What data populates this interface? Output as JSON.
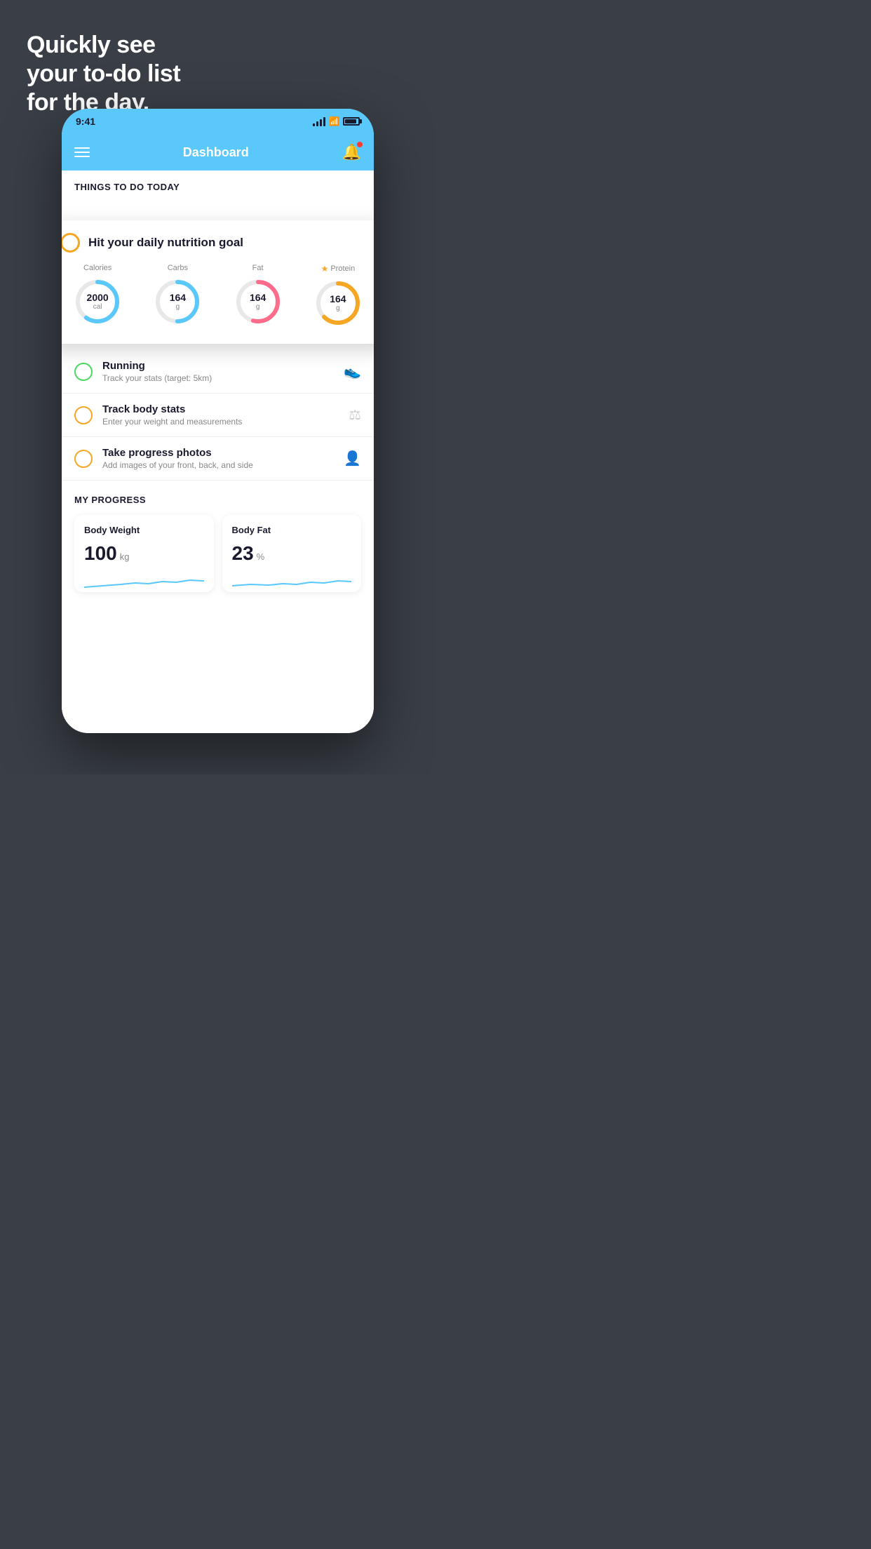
{
  "page": {
    "background_color": "#3a3f47",
    "headline_line1": "Quickly see",
    "headline_line2": "your to-do list",
    "headline_line3": "for the day."
  },
  "status_bar": {
    "time": "9:41",
    "background": "#5ac8fa"
  },
  "nav": {
    "title": "Dashboard"
  },
  "things_section": {
    "header": "THINGS TO DO TODAY"
  },
  "floating_card": {
    "title": "Hit your daily nutrition goal",
    "nutrition": [
      {
        "label": "Calories",
        "value": "2000",
        "unit": "cal",
        "color": "#5ac8fa",
        "star": false
      },
      {
        "label": "Carbs",
        "value": "164",
        "unit": "g",
        "color": "#5ac8fa",
        "star": false
      },
      {
        "label": "Fat",
        "value": "164",
        "unit": "g",
        "color": "#ff6b8a",
        "star": false
      },
      {
        "label": "Protein",
        "value": "164",
        "unit": "g",
        "color": "#f5a623",
        "star": true
      }
    ]
  },
  "todo_items": [
    {
      "name": "Running",
      "desc": "Track your stats (target: 5km)",
      "circle_color": "green",
      "icon": "👟"
    },
    {
      "name": "Track body stats",
      "desc": "Enter your weight and measurements",
      "circle_color": "yellow",
      "icon": "⚖"
    },
    {
      "name": "Take progress photos",
      "desc": "Add images of your front, back, and side",
      "circle_color": "yellow",
      "icon": "👤"
    }
  ],
  "progress_section": {
    "header": "MY PROGRESS",
    "cards": [
      {
        "title": "Body Weight",
        "value": "100",
        "unit": "kg"
      },
      {
        "title": "Body Fat",
        "value": "23",
        "unit": "%"
      }
    ]
  }
}
